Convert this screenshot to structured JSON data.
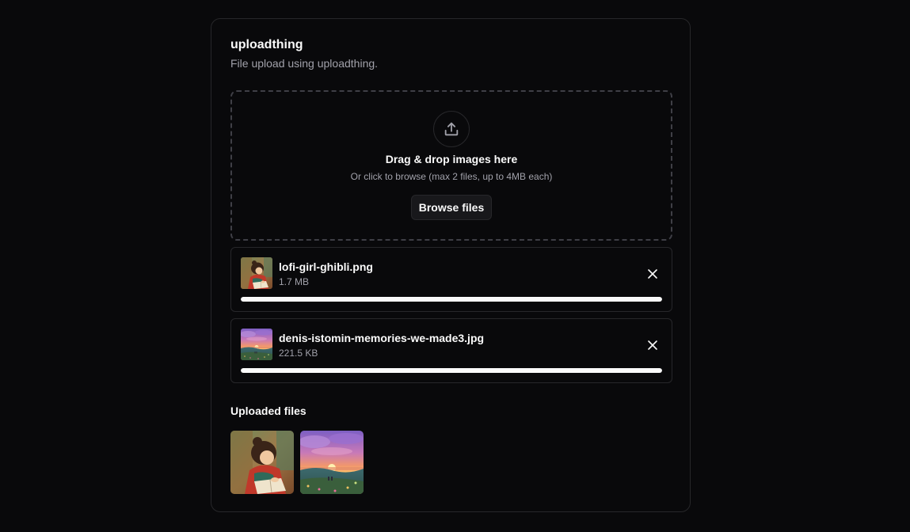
{
  "card": {
    "title": "uploadthing",
    "description": "File upload using uploadthing."
  },
  "dropzone": {
    "icon": "upload-icon",
    "title": "Drag & drop images here",
    "subtitle": "Or click to browse (max 2 files, up to 4MB each)",
    "browse_label": "Browse files"
  },
  "files": [
    {
      "name": "lofi-girl-ghibli.png",
      "size": "1.7 MB",
      "progress": 1.0,
      "thumb_icon": "lofi-girl-thumbnail"
    },
    {
      "name": "denis-istomin-memories-we-made3.jpg",
      "size": "221.5 KB",
      "progress": 1.0,
      "thumb_icon": "sunset-landscape-thumbnail"
    }
  ],
  "uploaded": {
    "title": "Uploaded files",
    "items": [
      "lofi-girl-image",
      "sunset-landscape-image"
    ]
  },
  "colors": {
    "background": "#09090b",
    "border": "#27272a",
    "text": "#fafafa",
    "muted": "#a1a1aa",
    "progress": "#fafafa"
  }
}
